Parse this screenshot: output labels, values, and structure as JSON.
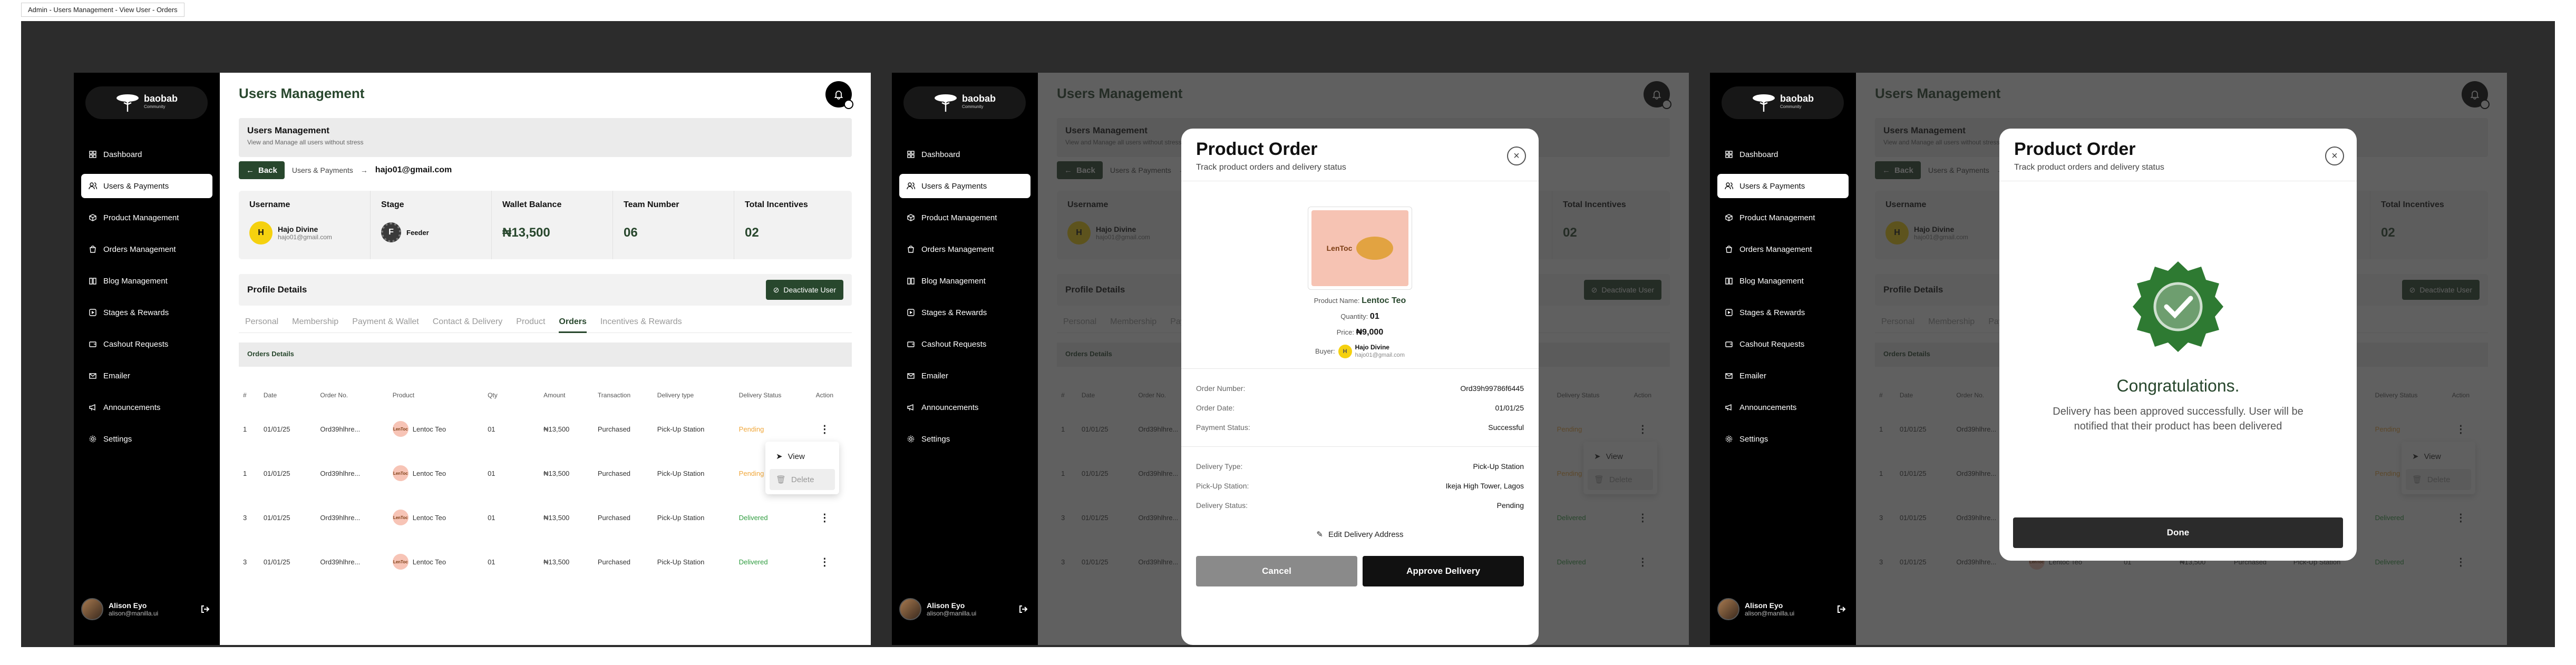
{
  "window": {
    "title": "Admin - Users Management - View User - Orders"
  },
  "brand": {
    "name": "baobab",
    "tagline": "Community"
  },
  "sidebar": {
    "items": [
      {
        "label": "Dashboard",
        "icon": "grid-icon"
      },
      {
        "label": "Users & Payments",
        "icon": "users-icon"
      },
      {
        "label": "Product Management",
        "icon": "box-icon"
      },
      {
        "label": "Orders Management",
        "icon": "bag-icon"
      },
      {
        "label": "Blog Management",
        "icon": "book-icon"
      },
      {
        "label": "Stages & Rewards",
        "icon": "stage-icon"
      },
      {
        "label": "Cashout Requests",
        "icon": "wallet-icon"
      },
      {
        "label": "Emailer",
        "icon": "mail-icon"
      },
      {
        "label": "Announcements",
        "icon": "megaphone-icon"
      },
      {
        "label": "Settings",
        "icon": "gear-icon"
      }
    ],
    "user": {
      "name": "Alison Eyo",
      "email": "alison@manilla.ui"
    }
  },
  "header": {
    "title": "Users Management"
  },
  "banner": {
    "title": "Users Management",
    "subtitle": "View and Manage all users without stress"
  },
  "breadcrumb": {
    "back": "Back",
    "section": "Users & Payments",
    "arrow": "→",
    "current": "hajo01@gmail.com"
  },
  "stats": {
    "username_label": "Username",
    "user_initial": "H",
    "user_name": "Hajo Divine",
    "user_email": "hajo01@gmail.com",
    "stage_label": "Stage",
    "stage_value": "Feeder",
    "stage_glyph": "F",
    "wallet_label": "Wallet Balance",
    "wallet_value": "₦13,500",
    "team_label": "Team Number",
    "team_value": "06",
    "incentives_label": "Total Incentives",
    "incentives_value": "02"
  },
  "profile": {
    "title": "Profile Details",
    "deactivate": "Deactivate User"
  },
  "tabs": [
    "Personal",
    "Membership",
    "Payment & Wallet",
    "Contact & Delivery",
    "Product",
    "Orders",
    "Incentives & Rewards"
  ],
  "orders_strip": "Orders Details",
  "table": {
    "headers": [
      "#",
      "Date",
      "Order No.",
      "Product",
      "Qty",
      "Amount",
      "Transaction",
      "Delivery type",
      "Delivery Status",
      "Action"
    ],
    "rows": [
      [
        "1",
        "01/01/25",
        "Ord39hlhre...",
        "Lentoc Teo",
        "01",
        "₦13,500",
        "Purchased",
        "Pick-Up Station",
        "Pending",
        "⋮"
      ],
      [
        "1",
        "01/01/25",
        "Ord39hlhre...",
        "Lentoc Teo",
        "01",
        "₦13,500",
        "Purchased",
        "Pick-Up Station",
        "Pending",
        "⋮"
      ],
      [
        "3",
        "01/01/25",
        "Ord39hlhre...",
        "Lentoc Teo",
        "01",
        "₦13,500",
        "Purchased",
        "Pick-Up Station",
        "Delivered",
        "⋮"
      ],
      [
        "3",
        "01/01/25",
        "Ord39hlhre...",
        "Lentoc Teo",
        "01",
        "₦13,500",
        "Purchased",
        "Pick-Up Station",
        "Delivered",
        "⋮"
      ]
    ],
    "thumb_text": "LenToc",
    "status_colors": {
      "Pending": "#f0a73a",
      "Delivered": "#2f9c3f"
    }
  },
  "action_menu": {
    "view": "View",
    "delete": "Delete"
  },
  "product_modal": {
    "title": "Product Order",
    "subtitle": "Track product orders and delivery status",
    "close": "×",
    "image_text": "LenToc",
    "product_name_label": "Product Name:",
    "product_name": "Lentoc Teo",
    "quantity_label": "Quantity:",
    "quantity": "01",
    "price_label": "Price:",
    "price": "₦9,000",
    "buyer_label": "Buyer:",
    "buyer_initial": "H",
    "buyer_name": "Hajo Divine",
    "buyer_email": "hajo01@gmail.com",
    "order_number_label": "Order Number:",
    "order_number": "Ord39h99786f6445",
    "order_date_label": "Order Date:",
    "order_date": "01/01/25",
    "payment_status_label": "Payment Status:",
    "payment_status": "Successful",
    "delivery_type_label": "Delivery Type:",
    "delivery_type": "Pick-Up Station",
    "pickup_label": "Pick-Up Station:",
    "pickup_station": "Ikeja High Tower, Lagos",
    "delivery_status_label": "Delivery Status:",
    "delivery_status": "Pending",
    "edit_address": "Edit Delivery Address",
    "cancel": "Cancel",
    "approve": "Approve Delivery"
  },
  "success_modal": {
    "title": "Product Order",
    "subtitle": "Track product orders and delivery status",
    "close": "×",
    "heading": "Congratulations.",
    "message": "Delivery has been approved successfully. User will be notified that their product has been delivered",
    "done": "Done"
  },
  "colors": {
    "brand_green": "#28472d",
    "pending": "#f0a73a",
    "delivered": "#2f9c3f",
    "canvas": "#2c2c2c"
  }
}
